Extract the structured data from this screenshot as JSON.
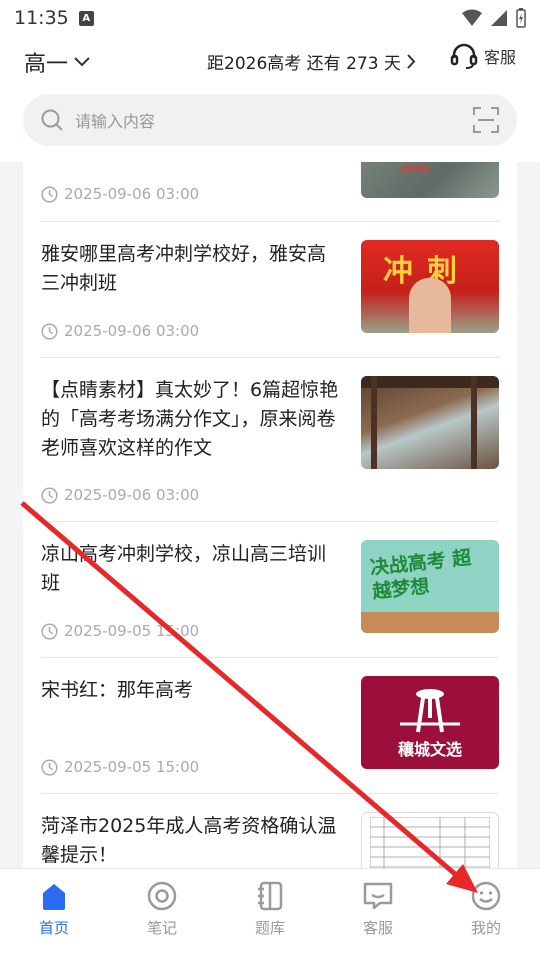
{
  "status": {
    "time": "11:35",
    "a_label": "A"
  },
  "header": {
    "grade": "高一",
    "countdown": "距2026高考 还有 273 天",
    "kefu": "客服"
  },
  "search": {
    "placeholder": "请输入内容"
  },
  "articles": [
    {
      "title": "",
      "date": "2025-09-06 03:00"
    },
    {
      "title": "雅安哪里高考冲刺学校好，雅安高三冲刺班",
      "date": "2025-09-06 03:00",
      "thumb_text": "冲刺"
    },
    {
      "title": "【点睛素材】真太妙了！6篇超惊艳的「高考考场满分作文」，原来阅卷老师喜欢这样的作文",
      "date": "2025-09-06 03:00"
    },
    {
      "title": "凉山高考冲刺学校，凉山高三培训班",
      "date": "2025-09-05 15:00",
      "thumb_text": "决战高考 超越梦想"
    },
    {
      "title": "宋书红：那年高考",
      "date": "2025-09-05 15:00",
      "thumb_text": "穰城文选"
    },
    {
      "title": "菏泽市2025年成人高考资格确认温馨提示！",
      "date": ""
    }
  ],
  "nav": [
    {
      "label": "首页",
      "icon": "home-icon",
      "active": true
    },
    {
      "label": "笔记",
      "icon": "notes-icon",
      "active": false
    },
    {
      "label": "题库",
      "icon": "question-bank-icon",
      "active": false
    },
    {
      "label": "客服",
      "icon": "chat-icon",
      "active": false
    },
    {
      "label": "我的",
      "icon": "smile-icon",
      "active": false
    }
  ],
  "colors": {
    "accent": "#2a6df4",
    "arrow": "#e8272a"
  }
}
